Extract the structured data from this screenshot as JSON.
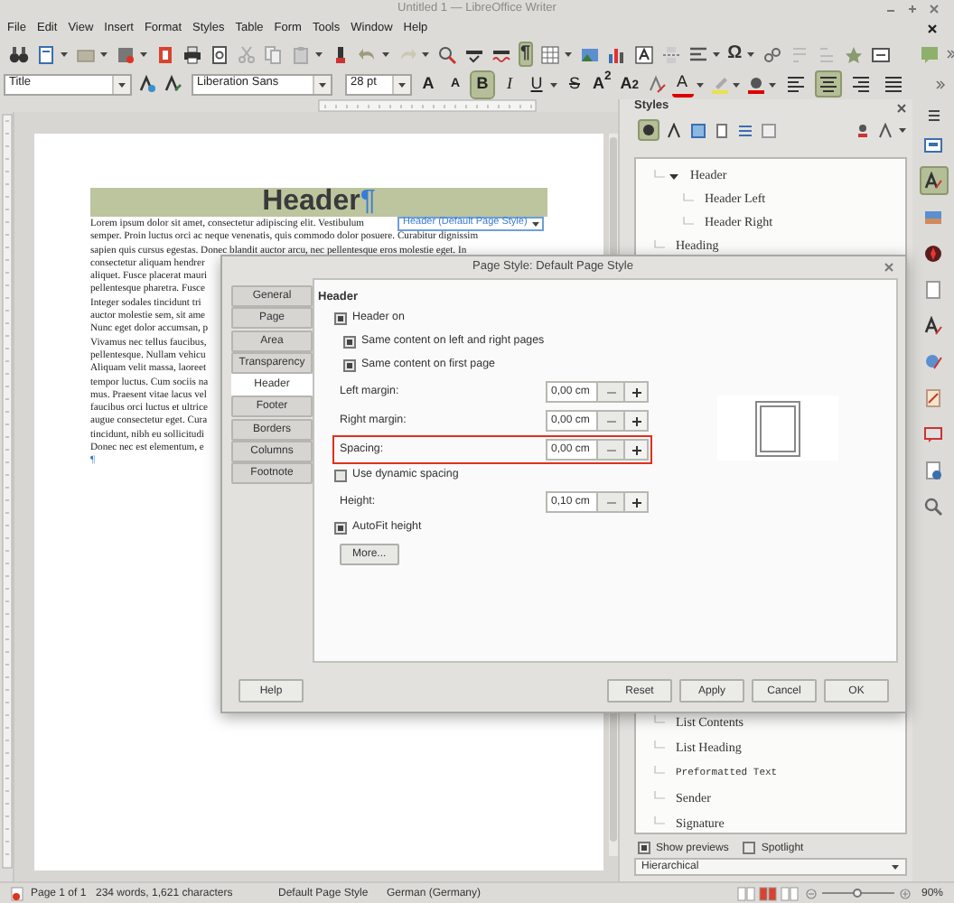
{
  "window": {
    "title": "Untitled 1 — LibreOffice Writer"
  },
  "menu": [
    "File",
    "Edit",
    "View",
    "Insert",
    "Format",
    "Styles",
    "Table",
    "Form",
    "Tools",
    "Window",
    "Help"
  ],
  "toolbar": {
    "formatting_marks": {
      "label": "¶",
      "selected": true
    },
    "special_character": "Ω"
  },
  "formatting": {
    "paragraph_style": "Title",
    "font_name": "Liberation Sans",
    "font_size": "28 pt",
    "buttons": [
      {
        "kind": "grow",
        "label": "A",
        "selected": false
      },
      {
        "kind": "shrink",
        "label": "A",
        "selected": false
      },
      {
        "kind": "bold",
        "label": "B",
        "selected": true
      },
      {
        "kind": "italic",
        "label": "I",
        "selected": false
      },
      {
        "kind": "underline",
        "label": "U",
        "selected": false
      },
      {
        "kind": "strike",
        "label": "S",
        "selected": false
      },
      {
        "kind": "superscript",
        "label": "A$^{2}$",
        "selected": false
      },
      {
        "kind": "subscript",
        "label": "A$_{2}$",
        "selected": false
      },
      {
        "kind": "font_color",
        "label": "A",
        "selected": false
      }
    ],
    "align": [
      {
        "kind": "left",
        "selected": false
      },
      {
        "kind": "center",
        "selected": true
      },
      {
        "kind": "right",
        "selected": false
      },
      {
        "kind": "justify",
        "selected": false
      }
    ]
  },
  "document": {
    "header": {
      "text": "Header",
      "mark": "¶",
      "tag": "Header (Default Page Style)"
    },
    "body_lines": [
      "Lorem ipsum dolor sit amet, consectetur adipiscing elit. Vestibulum",
      "semper. Proin luctus orci ac neque venenatis, quis commodo dolor posuere. Curabitur dignissim",
      "sapien quis cursus egestas. Donec blandit auctor arcu, nec pellentesque eros molestie eget. In",
      "consectetur aliquam hendrer",
      "aliquet. Fusce placerat mauri",
      "pellentesque pharetra. Fusce",
      "Integer sodales tincidunt tri",
      "auctor molestie sem, sit ame",
      "Nunc eget dolor accumsan, p",
      "Vivamus nec tellus faucibus,",
      "pellentesque. Nullam vehicu",
      "Aliquam velit massa, laoreet",
      "tempor luctus. Cum sociis na",
      "mus. Praesent vitae lacus vel",
      "faucibus orci luctus et ultrice",
      "augue consectetur eget. Cura",
      "tincidunt, nibh eu sollicitudi",
      "Donec nec est elementum, e"
    ],
    "end_mark": "¶"
  },
  "dialog": {
    "title": "Page Style: Default Page Style",
    "tabs": [
      {
        "label": "General",
        "selected": false
      },
      {
        "label": "Page",
        "selected": false
      },
      {
        "label": "Area",
        "selected": false
      },
      {
        "label": "Transparency",
        "selected": false
      },
      {
        "label": "Header",
        "selected": true
      },
      {
        "label": "Footer",
        "selected": false
      },
      {
        "label": "Borders",
        "selected": false
      },
      {
        "label": "Columns",
        "selected": false
      },
      {
        "label": "Footnote",
        "selected": false
      }
    ],
    "section": "Header",
    "rows": [
      {
        "kind": "checkbox",
        "label": "Header on",
        "checked": true,
        "children": [
          {
            "kind": "checkbox",
            "label": "Same content on left and right pages",
            "checked": true
          },
          {
            "kind": "checkbox",
            "label": "Same content on first page",
            "checked": true
          }
        ]
      },
      {
        "kind": "spin",
        "label": "Left margin:",
        "value": "0,00 cm",
        "highlighted": false
      },
      {
        "kind": "spin",
        "label": "Right margin:",
        "value": "0,00 cm",
        "highlighted": false
      },
      {
        "kind": "spin",
        "label": "Spacing:",
        "value": "0,00 cm",
        "highlighted": true
      },
      {
        "kind": "checkbox",
        "label": "Use dynamic spacing",
        "checked": false
      },
      {
        "kind": "spin",
        "label": "Height:",
        "value": "0,10 cm",
        "highlighted": false
      },
      {
        "kind": "checkbox",
        "label": "AutoFit height",
        "checked": true
      },
      {
        "kind": "button",
        "label": "More..."
      }
    ],
    "buttons": [
      "Help",
      "Reset",
      "Apply",
      "Cancel",
      "OK"
    ]
  },
  "styles_panel": {
    "title": "Styles",
    "items_top": [
      {
        "label": "Header",
        "kind": "text",
        "expanded": true,
        "children": [
          {
            "label": "Header Left",
            "kind": "text"
          },
          {
            "label": "Header Right",
            "kind": "text"
          }
        ]
      },
      {
        "label": "Heading",
        "kind": "text"
      }
    ],
    "items_bottom": [
      {
        "label": "List Contents",
        "kind": "text"
      },
      {
        "label": "List Heading",
        "kind": "text"
      },
      {
        "label": "Preformatted Text",
        "kind": "preformatted"
      },
      {
        "label": "Sender",
        "kind": "text"
      },
      {
        "label": "Signature",
        "kind": "text"
      }
    ],
    "show_previews": {
      "label": "Show previews",
      "checked": true
    },
    "spotlight": {
      "label": "Spotlight",
      "checked": false
    },
    "filter": "Hierarchical"
  },
  "sidebar_tabs": [
    {
      "kind": "properties",
      "selected": false
    },
    {
      "kind": "styles",
      "selected": true
    },
    {
      "kind": "gallery",
      "selected": false
    },
    {
      "kind": "navigator",
      "selected": false
    },
    {
      "kind": "page",
      "selected": false
    },
    {
      "kind": "inspector",
      "selected": false
    },
    {
      "kind": "changes",
      "selected": false
    },
    {
      "kind": "design",
      "selected": false
    },
    {
      "kind": "comment",
      "selected": false
    },
    {
      "kind": "info",
      "selected": false
    },
    {
      "kind": "find",
      "selected": false
    }
  ],
  "status_bar": {
    "page": "Page 1 of 1",
    "counts": "234 words, 1,621 characters",
    "page_style": "Default Page Style",
    "language": "German (Germany)",
    "views": [
      {
        "selected": false
      },
      {
        "selected": true
      },
      {
        "selected": false
      }
    ],
    "zoom": {
      "level": 0.5
    },
    "zoom_text": "90%"
  }
}
